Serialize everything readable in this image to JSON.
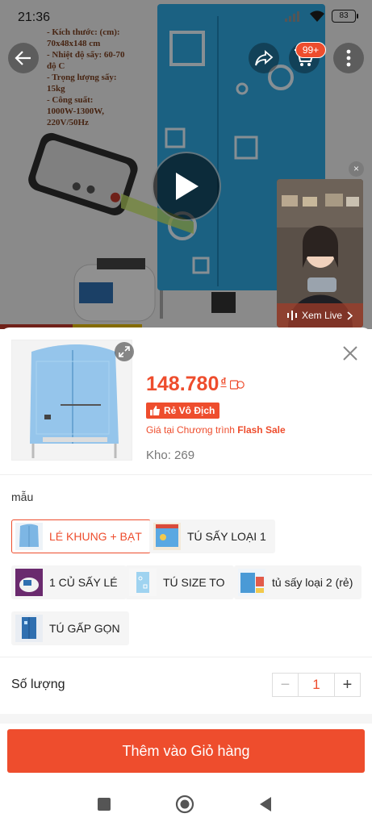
{
  "status_bar": {
    "time": "21:36",
    "battery": "83"
  },
  "product_image": {
    "specs": [
      "- Kích thước: (cm):",
      "70x48x148 cm",
      "- Nhiệt độ sấy: 60-70",
      "độ C",
      "- Trọng lượng sấy:",
      "15kg",
      "- Công suất:",
      "1000W-1300W,",
      "220V/50Hz"
    ]
  },
  "header": {
    "cart_badge": "99+"
  },
  "live": {
    "label": "Xem Live",
    "close": "×"
  },
  "sheet": {
    "price": "148.780",
    "currency": "₫",
    "badge": "Rẻ Vô Địch",
    "flash_note_prefix": "Giá tại Chương trình ",
    "flash_note_highlight": "Flash Sale",
    "stock": "Kho: 269",
    "variation_label": "mẫu",
    "options": [
      {
        "label": "LÉ KHUNG + BẠT",
        "selected": true
      },
      {
        "label": "TÚ SẤY LOẠI 1",
        "selected": false
      },
      {
        "label": "1 CỦ SẤY LÉ",
        "selected": false
      },
      {
        "label": "TÚ SIZE TO",
        "selected": false
      },
      {
        "label": "tủ sấy loại 2 (rẻ)",
        "selected": false
      },
      {
        "label": "TÚ GẤP GỌN",
        "selected": false
      }
    ],
    "quantity_label": "Số lượng",
    "quantity_minus": "−",
    "quantity_value": "1",
    "quantity_plus": "+",
    "add_to_cart": "Thêm vào Giỏ hàng"
  },
  "colors": {
    "accent": "#ee4d2d",
    "cabinet_blue": "#2fa8e0"
  }
}
